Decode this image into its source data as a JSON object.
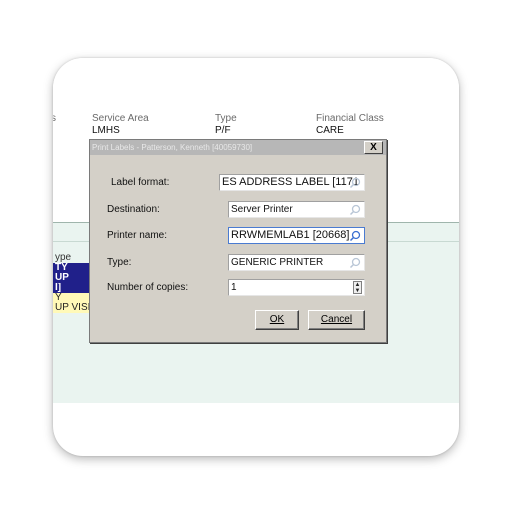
{
  "header": {
    "partial_col": "s",
    "service_area_label": "Service Area",
    "service_area_value": "LMHS",
    "type_label": "Type",
    "type_value": "P/F",
    "financial_class_label": "Financial Class",
    "financial_class_value": "CARE"
  },
  "left_list": {
    "type_header": "ype",
    "rows": [
      "TY",
      "UP",
      "I]",
      "Y",
      "UP VISIT"
    ]
  },
  "dialog": {
    "title": "Print Labels - Patterson, Kenneth [40059730]",
    "close_label": "X",
    "fields": {
      "label_format": {
        "label": "Label format:",
        "value": "ES ADDRESS LABEL [1171"
      },
      "destination": {
        "label": "Destination:",
        "value": "Server Printer"
      },
      "printer_name": {
        "label": "Printer name:",
        "value": "RRWMEMLAB1 [20668]"
      },
      "type": {
        "label": "Type:",
        "value": "GENERIC PRINTER"
      },
      "copies": {
        "label": "Number of copies:",
        "value": "1"
      }
    },
    "ok_label": "OK",
    "cancel_label": "Cancel"
  },
  "colors": {
    "accent_blue": "#20208a",
    "highlight_yellow": "#fff9b8",
    "panel_green": "#eaf4f0",
    "dialog_gray": "#d4d0c8"
  }
}
